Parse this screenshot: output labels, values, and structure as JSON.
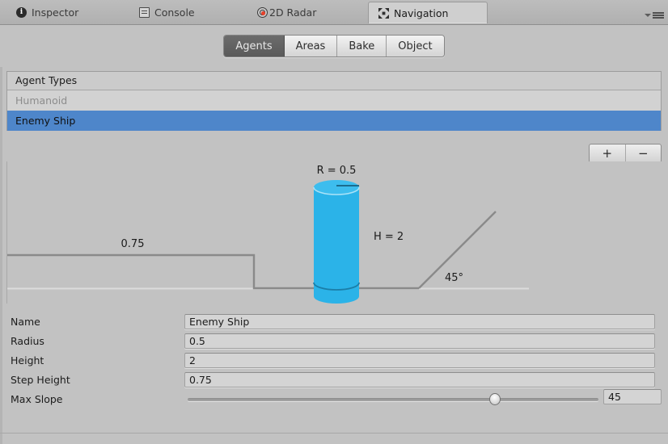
{
  "window": {
    "tabs": [
      {
        "label": "Inspector",
        "icon": "info-icon",
        "active": false
      },
      {
        "label": "Console",
        "icon": "console-icon",
        "active": false
      },
      {
        "label": "2D Radar",
        "icon": "radar-icon",
        "active": false
      },
      {
        "label": "Navigation",
        "icon": "navigation-icon",
        "active": true
      }
    ],
    "panel_menu_icon": "panel-menu-icon"
  },
  "modebar": {
    "buttons": [
      {
        "label": "Agents",
        "selected": true
      },
      {
        "label": "Areas",
        "selected": false
      },
      {
        "label": "Bake",
        "selected": false
      },
      {
        "label": "Object",
        "selected": false
      }
    ]
  },
  "agent_types": {
    "header": "Agent Types",
    "rows": [
      {
        "label": "Humanoid",
        "state": "disabled"
      },
      {
        "label": "Enemy Ship",
        "state": "selected"
      }
    ],
    "add_label": "+",
    "remove_label": "−"
  },
  "diagram": {
    "radius_label": "R = 0.5",
    "height_label": "H = 2",
    "step_label": "0.75",
    "slope_label": "45°",
    "agent_color": "#2bb3e8",
    "agent_color_dark": "#1f95c6",
    "line_color": "#7f7f7f"
  },
  "properties": {
    "name": {
      "label": "Name",
      "value": "Enemy Ship",
      "placeholder": ""
    },
    "radius": {
      "label": "Radius",
      "value": "0.5",
      "placeholder": ""
    },
    "height": {
      "label": "Height",
      "value": "2",
      "placeholder": ""
    },
    "step_height": {
      "label": "Step Height",
      "value": "0.75",
      "placeholder": ""
    },
    "max_slope": {
      "label": "Max Slope",
      "value": "45",
      "percent": 75
    }
  },
  "colors": {
    "background": "#c2c2c2",
    "selection_blue": "#4e86ca",
    "accent_cyan": "#2bb3e8"
  }
}
